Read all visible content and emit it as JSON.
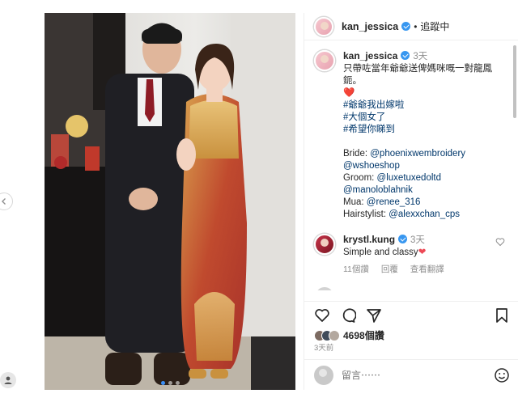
{
  "header": {
    "username": "kan_jessica",
    "separator": "•",
    "follow_status": "追蹤中"
  },
  "caption": {
    "username": "kan_jessica",
    "time": "3天",
    "text": "只帶咗當年爺爺送俾媽咪嘅一對龍鳳鈪。",
    "heart": "❤️",
    "hashtags": [
      "#爺爺我出嫁啦",
      "#大個女了",
      "#希望你睇到"
    ],
    "credits": [
      {
        "label": "Bride: ",
        "mention": "@phoenixwembroidery"
      },
      {
        "label": "",
        "mention": "@wshoeshop"
      },
      {
        "label": "Groom: ",
        "mention": "@luxetuxedoltd"
      },
      {
        "label": "",
        "mention": "@manoloblahnik"
      },
      {
        "label": "Mua: ",
        "mention": "@renee_316"
      },
      {
        "label": "Hairstylist: ",
        "mention": "@alexxchan_cps"
      }
    ]
  },
  "comment": {
    "username": "krystl.kung",
    "time": "3天",
    "text": "Simple and classy",
    "heart": "❤",
    "likes": "11個讚",
    "reply": "回覆",
    "translate": "查看翻譯"
  },
  "likes_count": "4698個讚",
  "posted_ago": "3天前",
  "add_comment_placeholder": "留言⋯⋯",
  "icons": {
    "like": "heart-icon",
    "comment": "comment-icon",
    "share": "share-icon",
    "save": "bookmark-icon",
    "emoji": "emoji-icon"
  },
  "colors": {
    "verified": "#3897f0",
    "link": "#00376b",
    "heart": "#ed4956",
    "carousel_active": "#3b8ff5"
  }
}
